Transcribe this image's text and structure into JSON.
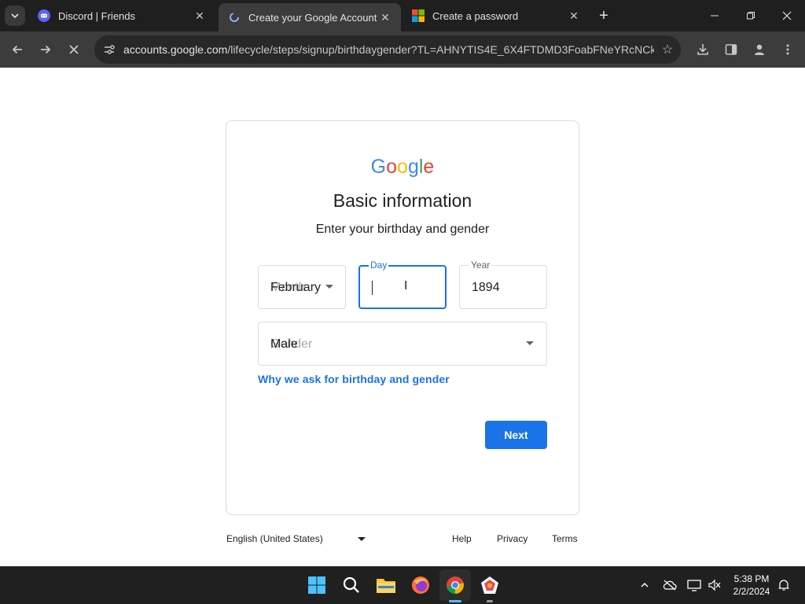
{
  "browser": {
    "tabs": [
      {
        "title": "Discord | Friends",
        "favicon": "discord-icon",
        "active": false
      },
      {
        "title": "Create your Google Account",
        "favicon": "google-loading-icon",
        "active": true
      },
      {
        "title": "Create a password",
        "favicon": "microsoft-icon",
        "active": false
      }
    ],
    "url_host": "accounts.google.com",
    "url_path": "/lifecycle/steps/signup/birthdaygender?TL=AHNYTIS4E_6X4FTDMD3FoabFNeYRcNCk..."
  },
  "page": {
    "logo": "Google",
    "heading": "Basic information",
    "subheading": "Enter your birthday and gender",
    "month": {
      "value": "February",
      "ghost": "Month"
    },
    "day": {
      "label": "Day",
      "value": ""
    },
    "year": {
      "label": "Year",
      "value": "1894"
    },
    "gender": {
      "value": "Male",
      "ghost": "Gender"
    },
    "why_link": "Why we ask for birthday and gender",
    "next_button": "Next"
  },
  "footer": {
    "language": "English (United States)",
    "help": "Help",
    "privacy": "Privacy",
    "terms": "Terms"
  },
  "taskbar": {
    "time": "5:38 PM",
    "date": "2/2/2024"
  },
  "colors": {
    "accent": "#1a73e8",
    "google_blue": "#4285f4",
    "google_red": "#ea4335",
    "google_yellow": "#fbbc05",
    "google_green": "#34a853"
  }
}
